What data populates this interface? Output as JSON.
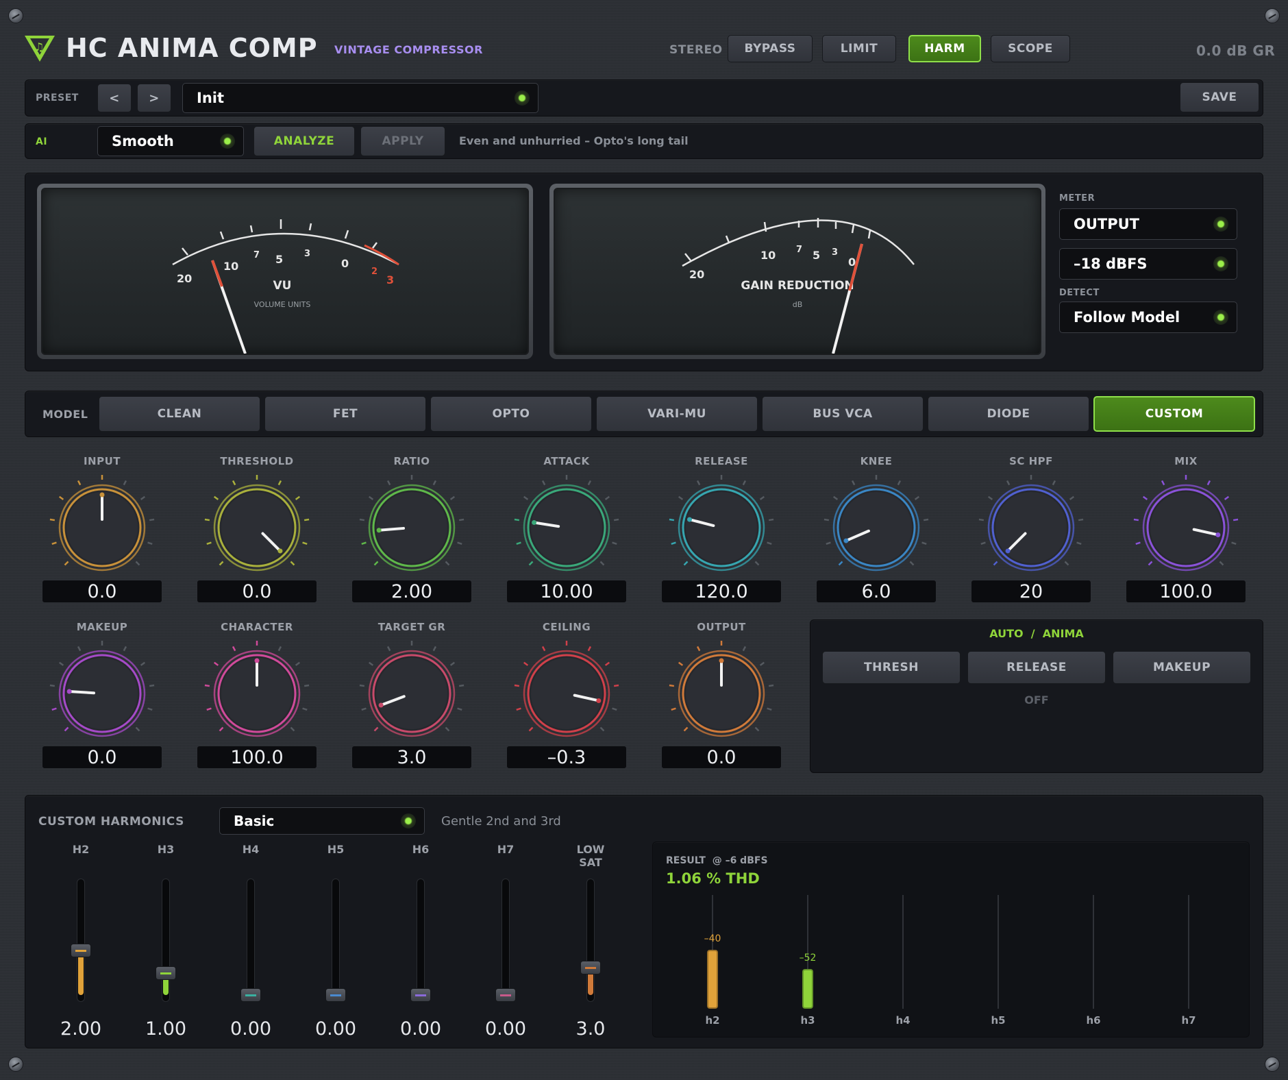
{
  "header": {
    "title": "HC ANIMA COMP",
    "subtitle": "VINTAGE COMPRESSOR",
    "stereo_label": "STEREO",
    "buttons": [
      {
        "label": "BYPASS",
        "active": false
      },
      {
        "label": "LIMIT",
        "active": false
      },
      {
        "label": "HARM",
        "active": true
      },
      {
        "label": "SCOPE",
        "active": false
      }
    ],
    "gr_readout": "0.0 dB GR"
  },
  "preset": {
    "label": "PRESET",
    "prev": "<",
    "next": ">",
    "name": "Init",
    "save": "SAVE"
  },
  "ai": {
    "label": "AI",
    "mode": "Smooth",
    "analyze": "ANALYZE",
    "apply": "APPLY",
    "description": "Even and unhurried – Opto's long tail"
  },
  "meters": {
    "vu": {
      "title": "VU",
      "subtitle": "VOLUME UNITS",
      "scale": [
        "20",
        "10",
        "7",
        "5",
        "3",
        "0",
        "2",
        "3"
      ]
    },
    "gr": {
      "title": "GAIN REDUCTION",
      "subtitle": "dB",
      "scale": [
        "20",
        "10",
        "7",
        "5",
        "3",
        "0"
      ]
    }
  },
  "meter_options": {
    "meter_label": "METER",
    "meter_source": "OUTPUT",
    "reference": "–18 dBFS",
    "detect_label": "DETECT",
    "detect": "Follow Model"
  },
  "model": {
    "label": "MODEL",
    "options": [
      "CLEAN",
      "FET",
      "OPTO",
      "VARI-MU",
      "BUS VCA",
      "DIODE",
      "CUSTOM"
    ],
    "selected": "CUSTOM"
  },
  "knobs_row1": [
    {
      "label": "INPUT",
      "value": "0.0",
      "pos": 0.5,
      "color": "#c8913a"
    },
    {
      "label": "THRESHOLD",
      "value": "0.0",
      "pos": 1.0,
      "color": "#a9b03c"
    },
    {
      "label": "RATIO",
      "value": "2.00",
      "pos": 0.15,
      "color": "#5fb84a"
    },
    {
      "label": "ATTACK",
      "value": "10.00",
      "pos": 0.2,
      "color": "#3aa87a"
    },
    {
      "label": "RELEASE",
      "value": "120.0",
      "pos": 0.22,
      "color": "#36a6b0"
    },
    {
      "label": "KNEE",
      "value": "6.0",
      "pos": 0.08,
      "color": "#3a86c4"
    },
    {
      "label": "SC HPF",
      "value": "20",
      "pos": 0.0,
      "color": "#5060d0"
    },
    {
      "label": "MIX",
      "value": "100.0",
      "pos": 0.88,
      "color": "#8a52d8"
    }
  ],
  "knobs_row2": [
    {
      "label": "MAKEUP",
      "value": "0.0",
      "pos": 0.18,
      "color": "#a54ac8"
    },
    {
      "label": "CHARACTER",
      "value": "100.0",
      "pos": 0.5,
      "color": "#d04a9a"
    },
    {
      "label": "TARGET GR",
      "value": "3.0",
      "pos": 0.09,
      "color": "#c84a6a"
    },
    {
      "label": "CEILING",
      "value": "–0.3",
      "pos": 0.88,
      "color": "#d0404a"
    },
    {
      "label": "OUTPUT",
      "value": "0.0",
      "pos": 0.5,
      "color": "#d07a3a"
    }
  ],
  "auto": {
    "title_a": "AUTO",
    "sep": "/",
    "title_b": "ANIMA",
    "buttons": [
      "THRESH",
      "RELEASE",
      "MAKEUP"
    ],
    "status": "OFF"
  },
  "harmonics": {
    "title": "CUSTOM HARMONICS",
    "preset": "Basic",
    "description": "Gentle 2nd and 3rd",
    "sliders": [
      {
        "label": "H2",
        "value": "2.00",
        "level": 0.4,
        "color": "#e0a23a"
      },
      {
        "label": "H3",
        "value": "1.00",
        "level": 0.2,
        "color": "#8fd43a"
      },
      {
        "label": "H4",
        "value": "0.00",
        "level": 0.0,
        "color": "#3ab0a0"
      },
      {
        "label": "H5",
        "value": "0.00",
        "level": 0.0,
        "color": "#4a8ad0"
      },
      {
        "label": "H6",
        "value": "0.00",
        "level": 0.0,
        "color": "#8a6ad8"
      },
      {
        "label": "H7",
        "value": "0.00",
        "level": 0.0,
        "color": "#c85a8a"
      },
      {
        "label": "LOW SAT",
        "value": "3.0",
        "level": 0.25,
        "color": "#d07a3a"
      }
    ],
    "result": {
      "label": "RESULT  @ –6 dBFS",
      "thd": "1.06 % THD",
      "bars": [
        {
          "label": "h2",
          "value": "–40",
          "level": 0.9,
          "color": "#e0a23a"
        },
        {
          "label": "h3",
          "value": "–52",
          "level": 0.6,
          "color": "#8fd43a"
        },
        {
          "label": "h4",
          "value": "",
          "level": 0,
          "color": "#555"
        },
        {
          "label": "h5",
          "value": "",
          "level": 0,
          "color": "#555"
        },
        {
          "label": "h6",
          "value": "",
          "level": 0,
          "color": "#555"
        },
        {
          "label": "h7",
          "value": "",
          "level": 0,
          "color": "#555"
        }
      ]
    }
  }
}
